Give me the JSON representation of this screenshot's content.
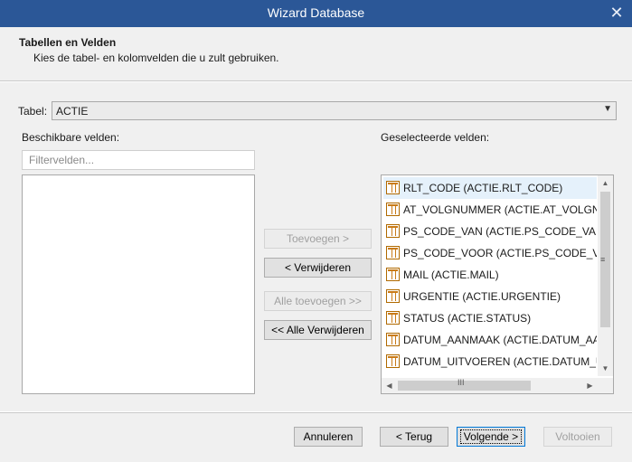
{
  "window": {
    "title": "Wizard Database",
    "close_glyph": "✕"
  },
  "header": {
    "title": "Tabellen en Velden",
    "subtitle": "Kies de tabel- en kolomvelden die u zult gebruiken."
  },
  "table_select": {
    "label": "Tabel:",
    "value": "ACTIE"
  },
  "available": {
    "label": "Beschikbare velden:",
    "filter_placeholder": "Filtervelden...",
    "items": []
  },
  "selected": {
    "label": "Geselecteerde velden:",
    "items": [
      {
        "label": "RLT_CODE (ACTIE.RLT_CODE)",
        "icon": "table-field-icon",
        "selected": true
      },
      {
        "label": "AT_VOLGNUMMER (ACTIE.AT_VOLGNUM",
        "icon": "table-field-icon"
      },
      {
        "label": "PS_CODE_VAN (ACTIE.PS_CODE_VAN)",
        "icon": "table-field-icon"
      },
      {
        "label": "PS_CODE_VOOR (ACTIE.PS_CODE_VOOR",
        "icon": "table-field-icon"
      },
      {
        "label": "MAIL (ACTIE.MAIL)",
        "icon": "table-field-icon"
      },
      {
        "label": "URGENTIE (ACTIE.URGENTIE)",
        "icon": "table-field-icon"
      },
      {
        "label": "STATUS (ACTIE.STATUS)",
        "icon": "table-field-icon"
      },
      {
        "label": "DATUM_AANMAAK (ACTIE.DATUM_AAN",
        "icon": "table-field-icon"
      },
      {
        "label": "DATUM_UITVOEREN (ACTIE.DATUM_UIT",
        "icon": "table-field-icon"
      }
    ],
    "scroll_grip": "≡",
    "hscroll_grip": "III"
  },
  "transfer_buttons": {
    "add": "Toevoegen >",
    "remove": "< Verwijderen",
    "add_all": "Alle toevoegen >>",
    "remove_all": "<< Alle Verwijderen"
  },
  "footer_buttons": {
    "cancel": "Annuleren",
    "back": "< Terug",
    "next": "Volgende >",
    "finish": "Voltooien"
  }
}
